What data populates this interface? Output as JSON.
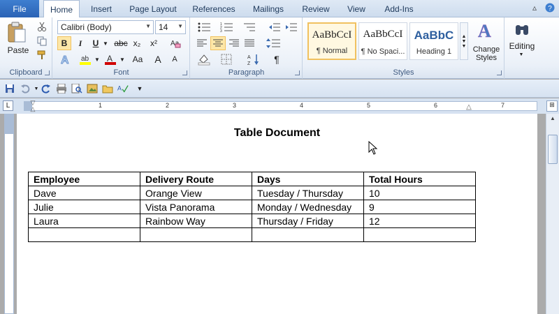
{
  "tabs": {
    "file": "File",
    "items": [
      {
        "label": "Home",
        "active": true
      },
      {
        "label": "Insert"
      },
      {
        "label": "Page Layout"
      },
      {
        "label": "References"
      },
      {
        "label": "Mailings"
      },
      {
        "label": "Review"
      },
      {
        "label": "View"
      },
      {
        "label": "Add-Ins"
      }
    ]
  },
  "ribbon": {
    "clipboard": {
      "paste_label": "Paste",
      "group_label": "Clipboard"
    },
    "font": {
      "font_name": "Calibri (Body)",
      "font_size": "14",
      "group_label": "Font",
      "bold": "B",
      "italic": "I",
      "underline": "U",
      "strikethrough": "abc",
      "subscript": "x₂",
      "superscript": "x²",
      "grow": "A",
      "shrink": "A",
      "change_case": "Aa"
    },
    "paragraph": {
      "group_label": "Paragraph",
      "pilcrow": "¶"
    },
    "styles": {
      "group_label": "Styles",
      "items": [
        {
          "sample": "AaBbCcI",
          "name": "¶ Normal"
        },
        {
          "sample": "AaBbCcI",
          "name": "¶ No Spaci..."
        },
        {
          "sample": "AaBbC",
          "name": "Heading 1"
        }
      ],
      "change_styles_label": "Change Styles"
    },
    "editing": {
      "label": "Editing"
    }
  },
  "ruler": {
    "numbers": [
      "1",
      "2",
      "3",
      "4",
      "5",
      "6",
      "7"
    ],
    "tab_selector": "L"
  },
  "document": {
    "title": "Table Document",
    "table": {
      "headers": [
        "Employee",
        "Delivery Route",
        "Days",
        "Total Hours"
      ],
      "rows": [
        [
          "Dave",
          "Orange View",
          "Tuesday / Thursday",
          "10"
        ],
        [
          "Julie",
          "Vista Panorama",
          "Monday / Wednesday",
          "9"
        ],
        [
          "Laura",
          "Rainbow Way",
          "Thursday / Friday",
          "12"
        ],
        [
          "",
          "",
          "",
          ""
        ]
      ]
    }
  },
  "colors": {
    "file_tab": "#2a62b5",
    "ribbon_bg": "#eaf0f8",
    "selected_style_border": "#f1c15f",
    "highlight": "#ffff00",
    "font_color": "#d00000"
  },
  "icons": {
    "quick_access": [
      "save-icon",
      "undo-icon",
      "redo-icon",
      "print-icon",
      "print-preview-icon",
      "insert-picture-icon",
      "open-icon",
      "spelling-icon",
      "customize-qat-icon"
    ]
  }
}
